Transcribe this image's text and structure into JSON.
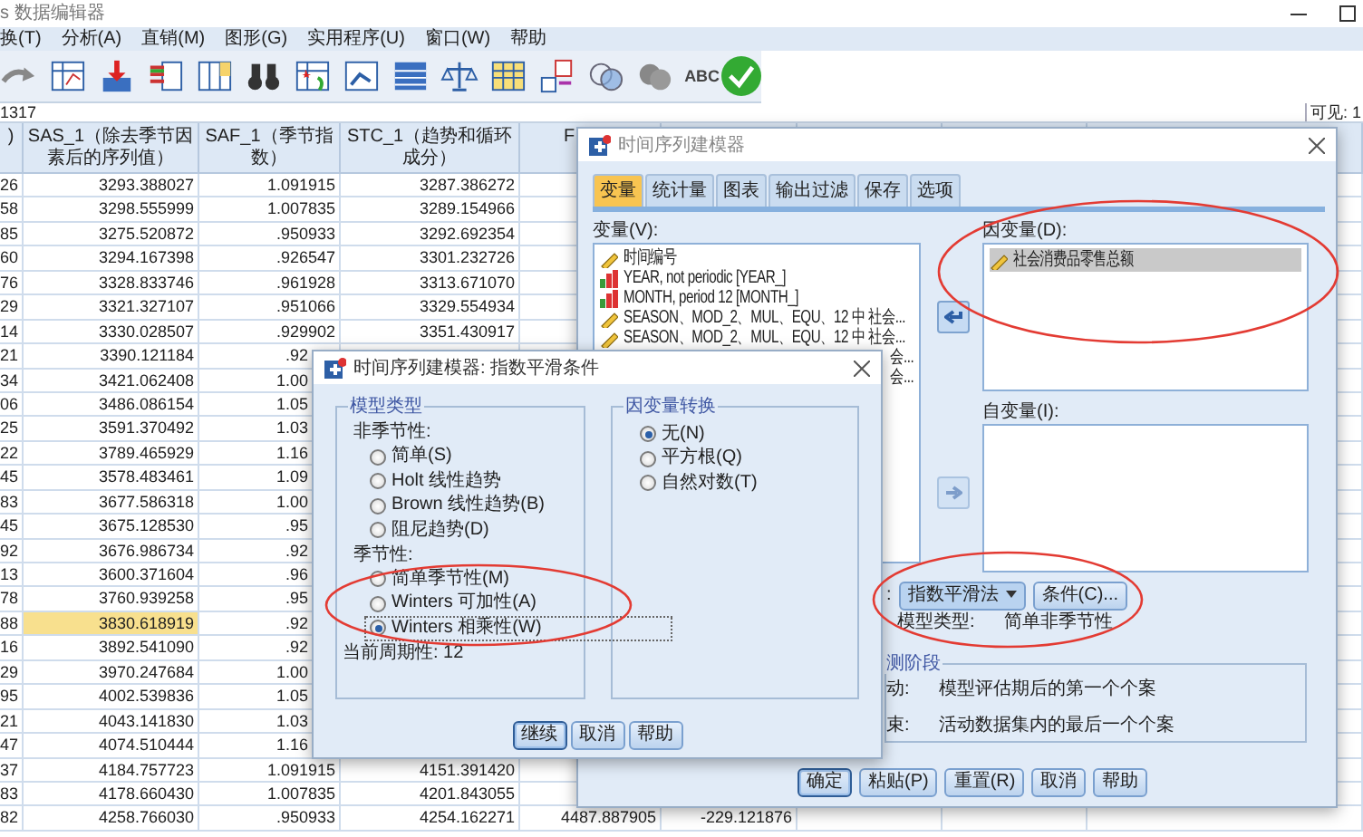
{
  "window": {
    "title": "s 数据编辑器"
  },
  "menu": [
    "换(T)",
    "分析(A)",
    "直销(M)",
    "图形(G)",
    "实用程序(U)",
    "窗口(W)",
    "帮助"
  ],
  "toolbar": {
    "spellcheck_text": "ABC"
  },
  "cell_bar": {
    "value": "1317",
    "visible_label": "可见: 1"
  },
  "grid": {
    "columns": [
      ")",
      "SAS_1（除去季节因素后的序列值）",
      "SAF_1（季节指数）",
      "STC_1（趋势和循环成分）",
      "F"
    ],
    "rows": [
      {
        "cells": [
          "26",
          "3293.388027",
          "1.091915",
          "3287.386272",
          null,
          null
        ],
        "selected": false
      },
      {
        "cells": [
          "58",
          "3298.555999",
          "1.007835",
          "3289.154966",
          null,
          null
        ],
        "selected": false
      },
      {
        "cells": [
          "85",
          "3275.520872",
          ".950933",
          "3292.692354",
          null,
          null
        ],
        "selected": false
      },
      {
        "cells": [
          "60",
          "3294.167398",
          ".926547",
          "3301.232726",
          null,
          null
        ],
        "selected": false
      },
      {
        "cells": [
          "76",
          "3328.833746",
          ".961928",
          "3313.671070",
          null,
          null
        ],
        "selected": false
      },
      {
        "cells": [
          "29",
          "3321.327107",
          ".951066",
          "3329.554934",
          null,
          null
        ],
        "selected": false
      },
      {
        "cells": [
          "14",
          "3330.028507",
          ".929902",
          "3351.430917",
          null,
          null
        ],
        "selected": false
      },
      {
        "cells": [
          "21",
          "3390.121184",
          ".92",
          null,
          null,
          null
        ],
        "selected": false
      },
      {
        "cells": [
          "34",
          "3421.062408",
          "1.00",
          null,
          null,
          null
        ],
        "selected": false
      },
      {
        "cells": [
          "06",
          "3486.086154",
          "1.05",
          null,
          null,
          null
        ],
        "selected": false
      },
      {
        "cells": [
          "25",
          "3591.370492",
          "1.03",
          null,
          null,
          null
        ],
        "selected": false
      },
      {
        "cells": [
          "22",
          "3789.465929",
          "1.16",
          null,
          null,
          null
        ],
        "selected": false
      },
      {
        "cells": [
          "45",
          "3578.483461",
          "1.09",
          null,
          null,
          null
        ],
        "selected": false
      },
      {
        "cells": [
          "83",
          "3677.586318",
          "1.00",
          null,
          null,
          null
        ],
        "selected": false
      },
      {
        "cells": [
          "45",
          "3675.128530",
          ".95",
          null,
          null,
          null
        ],
        "selected": false
      },
      {
        "cells": [
          "92",
          "3676.986734",
          ".92",
          null,
          null,
          null
        ],
        "selected": false
      },
      {
        "cells": [
          "13",
          "3600.371604",
          ".96",
          null,
          null,
          null
        ],
        "selected": false
      },
      {
        "cells": [
          "78",
          "3760.939258",
          ".95",
          null,
          null,
          null
        ],
        "selected": false
      },
      {
        "cells": [
          "88",
          "3830.618919",
          ".92",
          null,
          null,
          null
        ],
        "selected": true
      },
      {
        "cells": [
          "16",
          "3892.541090",
          ".92",
          null,
          null,
          null
        ],
        "selected": false
      },
      {
        "cells": [
          "29",
          "3970.247684",
          "1.00",
          null,
          null,
          null
        ],
        "selected": false
      },
      {
        "cells": [
          "95",
          "4002.539836",
          "1.05",
          null,
          null,
          null
        ],
        "selected": false
      },
      {
        "cells": [
          "21",
          "4043.141830",
          "1.03",
          null,
          null,
          null
        ],
        "selected": false
      },
      {
        "cells": [
          "47",
          "4074.510444",
          "1.16",
          null,
          null,
          null
        ],
        "selected": false
      },
      {
        "cells": [
          "37",
          "4184.757723",
          "1.091915",
          "4151.391420",
          null,
          null
        ],
        "selected": false
      },
      {
        "cells": [
          "83",
          "4178.660430",
          "1.007835",
          "4201.843055",
          null,
          null
        ],
        "selected": false
      },
      {
        "cells": [
          "82",
          "4258.766030",
          ".950933",
          "4254.162271",
          "4487.887905",
          "-229.121876"
        ],
        "selected": false
      }
    ]
  },
  "modeler": {
    "title": "时间序列建模器",
    "tabs": [
      {
        "label": "变量",
        "selected": true
      },
      {
        "label": "统计量",
        "selected": false
      },
      {
        "label": "图表",
        "selected": false
      },
      {
        "label": "输出过滤",
        "selected": false
      },
      {
        "label": "保存",
        "selected": false
      },
      {
        "label": "选项",
        "selected": false
      }
    ],
    "variables_label": "变量(V):",
    "variables": [
      {
        "kind": "scale",
        "label": "时间编号"
      },
      {
        "kind": "nominal",
        "label": "YEAR, not periodic [YEAR_]"
      },
      {
        "kind": "nominal",
        "label": "MONTH, period 12 [MONTH_]"
      },
      {
        "kind": "scale",
        "label": "SEASON、MOD_2、MUL、EQU、12 中 社会..."
      },
      {
        "kind": "scale",
        "label": "SEASON、MOD_2、MUL、EQU、12 中 社会..."
      },
      {
        "kind": "cut",
        "label": "会..."
      },
      {
        "kind": "cut",
        "label": "会..."
      }
    ],
    "move_buttons": [
      {
        "disabled": false
      },
      {
        "disabled": true
      }
    ],
    "dependent_label": "因变量(D):",
    "dependent": [
      {
        "label": "社会消费品零售总额",
        "selected": true
      }
    ],
    "independent_label": "自变量(I):",
    "method_label": ":",
    "method": "指数平滑法",
    "criteria_button": "条件(C)...",
    "model_type_label": "模型类型:",
    "model_type": "简单非季节性",
    "period_group": {
      "legend": "测阶段",
      "rows": [
        {
          "label": "动:",
          "value": "模型评估期后的第一个个案"
        },
        {
          "label": "束:",
          "value": "活动数据集内的最后一个个案"
        }
      ]
    },
    "buttons": [
      {
        "label": "确定",
        "default": true
      },
      {
        "label": "粘贴(P)",
        "default": false
      },
      {
        "label": "重置(R)",
        "default": false
      },
      {
        "label": "取消",
        "default": false
      },
      {
        "label": "帮助",
        "default": false
      }
    ]
  },
  "criteria": {
    "title": "时间序列建模器: 指数平滑条件",
    "model_group": {
      "legend": "模型类型",
      "sections": [
        {
          "heading": "非季节性:",
          "options": [
            {
              "label": "简单(S)",
              "checked": false,
              "focused": false
            },
            {
              "label": "Holt 线性趋势",
              "checked": false,
              "focused": false
            },
            {
              "label": "Brown 线性趋势(B)",
              "checked": false,
              "focused": false
            },
            {
              "label": "阻尼趋势(D)",
              "checked": false,
              "focused": false
            }
          ]
        },
        {
          "heading": "季节性:",
          "options": [
            {
              "label": "简单季节性(M)",
              "checked": false,
              "focused": false
            },
            {
              "label": "Winters 可加性(A)",
              "checked": false,
              "focused": false
            },
            {
              "label": "Winters 相乘性(W)",
              "checked": true,
              "focused": true
            }
          ]
        }
      ],
      "note": "当前周期性: 12"
    },
    "transform_group": {
      "legend": "因变量转换",
      "options": [
        {
          "label": "无(N)",
          "checked": true,
          "focused": false
        },
        {
          "label": "平方根(Q)",
          "checked": false,
          "focused": false
        },
        {
          "label": "自然对数(T)",
          "checked": false,
          "focused": false
        }
      ]
    },
    "buttons": [
      {
        "label": "继续",
        "default": true
      },
      {
        "label": "取消",
        "default": false
      },
      {
        "label": "帮助",
        "default": false
      }
    ]
  }
}
